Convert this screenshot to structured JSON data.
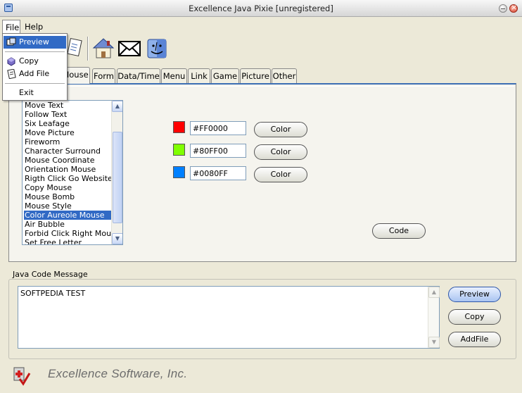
{
  "window": {
    "title": "Excellence Java Pixie  [unregistered]"
  },
  "menubar": {
    "file": "File",
    "help": "Help"
  },
  "file_menu": {
    "items": [
      {
        "label": "Preview",
        "icon": "preview-icon"
      },
      {
        "label": "Copy",
        "icon": "copy-icon"
      },
      {
        "label": "Add File",
        "icon": "add-file-icon"
      },
      {
        "label": "Exit"
      }
    ]
  },
  "toolbar": {
    "icons": [
      "document-icon",
      "home-icon",
      "mail-icon",
      "finder-icon"
    ]
  },
  "tabs": [
    "Mouse",
    "Form",
    "Data/Time",
    "Menu",
    "Link",
    "Game",
    "Picture",
    "Other"
  ],
  "effects_list": {
    "items": [
      "Move Text",
      "Follow Text",
      "Six Leafage",
      "Move Picture",
      "Fireworm",
      "Character Surround",
      "Mouse Coordinate",
      "Orientation Mouse",
      "Rigth Click Go Website",
      "Copy Mouse",
      "Mouse Bomb",
      "Mouse Style",
      "Color Aureole Mouse",
      "Air Bubble",
      "Forbid Click Right Mouse",
      "Set Free Letter"
    ],
    "selected": "Color Aureole Mouse"
  },
  "colors": [
    {
      "hex": "#FF0000",
      "button": "Color"
    },
    {
      "hex": "#80FF00",
      "button": "Color"
    },
    {
      "hex": "#0080FF",
      "button": "Color"
    }
  ],
  "code_button": "Code",
  "java_code": {
    "legend": "Java Code Message",
    "text": "SOFTPEDIA TEST",
    "buttons": {
      "preview": "Preview",
      "copy": "Copy",
      "addfile": "AddFile"
    }
  },
  "footer": {
    "company": "Excellence Software, Inc."
  },
  "palette": {
    "accent": "#316ac5",
    "tab_highlight": "#3d6fb4"
  }
}
